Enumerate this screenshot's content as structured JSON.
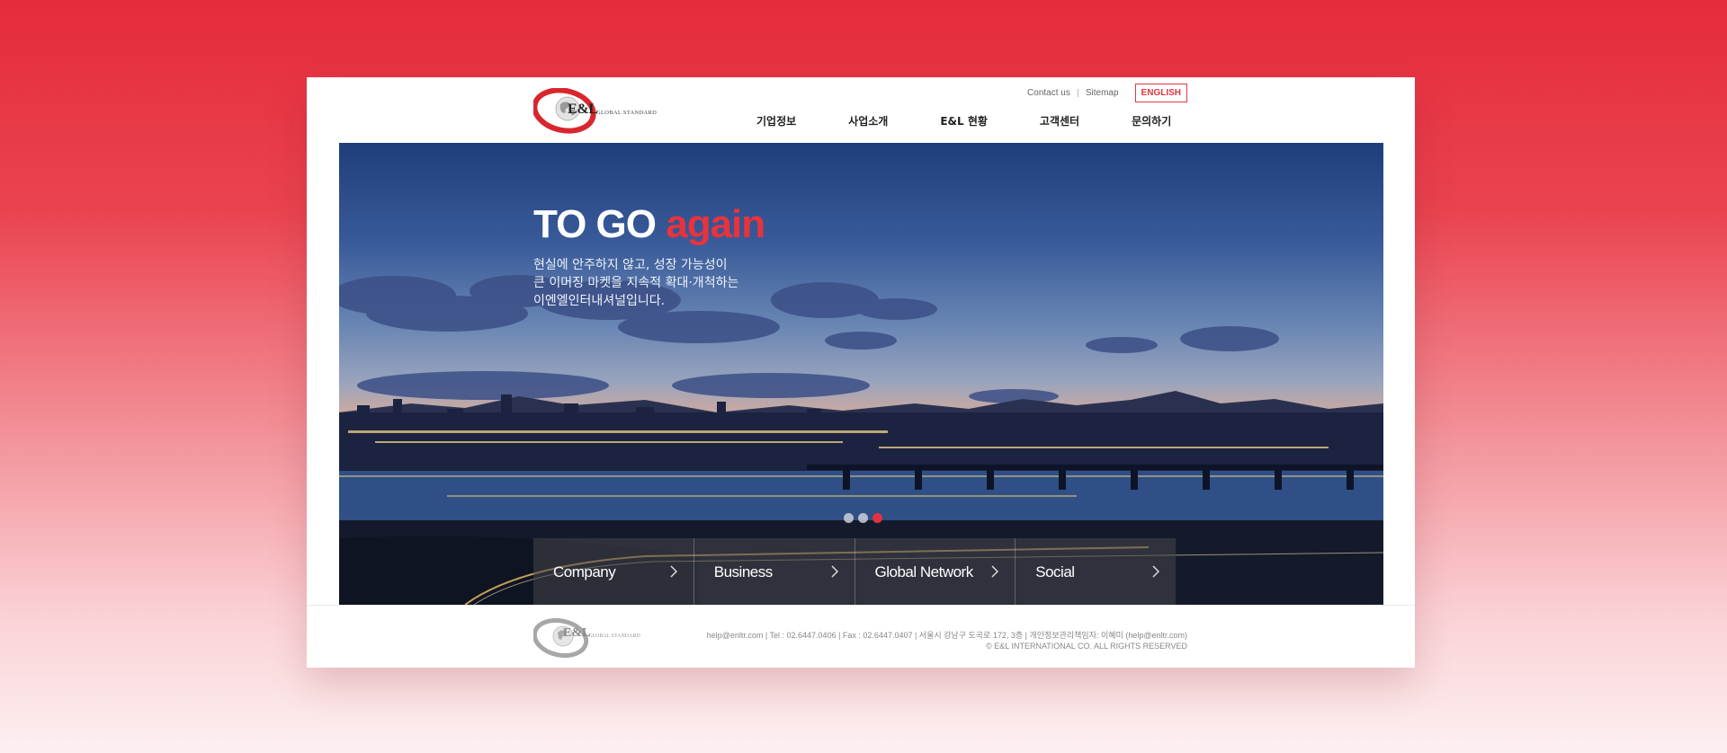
{
  "header": {
    "logo_text": "E&L",
    "logo_tagline": "GLOBAL STANDARD",
    "utility_links": [
      "Contact us",
      "Sitemap"
    ],
    "language_button": "ENGLISH",
    "nav": [
      "기업정보",
      "사업소개",
      "E&L 현황",
      "고객센터",
      "문의하기"
    ]
  },
  "hero": {
    "title_main": "TO GO ",
    "title_accent": "again",
    "description": [
      "현실에 안주하지 않고, 성장 가능성이",
      "큰 이머징 마켓을 지속적 확대·개척하는",
      "이엔엘인터내셔널입니다."
    ],
    "slides": 3,
    "active_slide": 3,
    "quick_links": [
      "Company",
      "Business",
      "Global Network",
      "Social"
    ]
  },
  "footer": {
    "logo_text": "E&L",
    "logo_tagline": "GLOBAL STANDARD",
    "contact_line": "help@enltr.com | Tel : 02.6447.0406 | Fax : 02.6447.0407 | 서울시 강남구 도곡로 172, 3층 | 개인정보관리책임자: 이혜미 (help@enltr.com)",
    "copyright": "© E&L INTERNATIONAL CO. ALL RIGHTS RESERVED"
  },
  "colors": {
    "accent": "#e0333c",
    "background_top": "#e52b3a",
    "background_bottom": "#fdf0f1"
  }
}
